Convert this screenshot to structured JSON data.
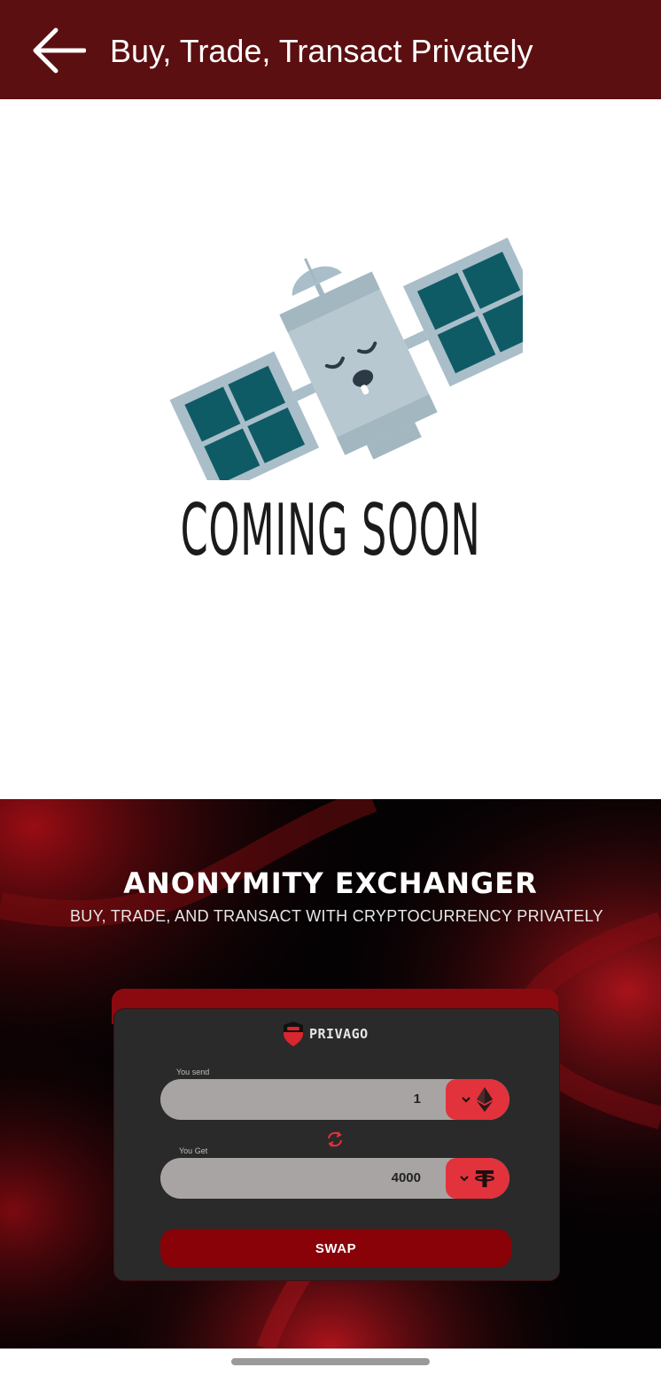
{
  "header": {
    "title": "Buy, Trade, Transact Privately",
    "back_icon": "arrow-left-icon"
  },
  "coming_soon": {
    "illustration": "sleeping-satellite-icon",
    "text": "COMING SOON"
  },
  "banner": {
    "title": "ANONYMITY EXCHANGER",
    "subtitle": "BUY, TRADE, AND TRANSACT WITH CRYPTOCURRENCY PRIVATELY",
    "brand": "PRIVAGO",
    "send_label": "You send",
    "send_value": "1",
    "send_coin_icon": "ethereum-icon",
    "get_label": "You Get",
    "get_value": "4000",
    "get_coin_icon": "tether-icon",
    "swap_label": "SWAP"
  },
  "colors": {
    "app_bar": "#5b0f11",
    "accent_red": "#e2323b",
    "swap_button": "#880208",
    "card": "#2a2a2a"
  }
}
